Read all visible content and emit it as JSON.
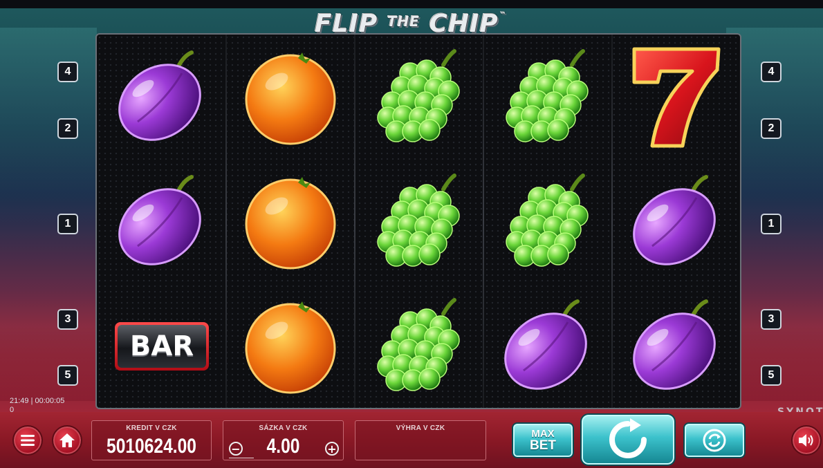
{
  "game": {
    "title_part1": "FLIP",
    "title_part2": "THE",
    "title_part3": "CHIP",
    "trademark": "™"
  },
  "paylines_left": [
    "4",
    "2",
    "1",
    "3",
    "5"
  ],
  "paylines_right": [
    "4",
    "2",
    "1",
    "3",
    "5"
  ],
  "reels": [
    [
      "plum",
      "plum",
      "bar"
    ],
    [
      "orange",
      "orange",
      "orange"
    ],
    [
      "grapes",
      "grapes",
      "grapes"
    ],
    [
      "grapes",
      "grapes",
      "plum"
    ],
    [
      "seven",
      "plum",
      "plum"
    ]
  ],
  "bar_symbol_text": "BAR",
  "status": {
    "clock": "21:49 | 00:00:05",
    "session_value": "0"
  },
  "credit": {
    "label": "KREDIT V CZK",
    "value": "5010624.00"
  },
  "bet": {
    "label": "SÁZKA V CZK",
    "value": "4.00",
    "minus": "−",
    "plus": "+"
  },
  "win": {
    "label": "VÝHRA V CZK",
    "value": ""
  },
  "buttons": {
    "max_bet_line1": "MAX",
    "max_bet_line2": "BET"
  },
  "brand_text": "SYNOT",
  "icons": {
    "menu": "menu-icon",
    "home": "home-icon",
    "spin": "spin-arrow-icon",
    "autoplay": "autoplay-icon",
    "sound": "speaker-icon"
  },
  "colors": {
    "bar_bg": "#8a1825",
    "teal_button": "#3cc2cc",
    "plum": "#8a2fc9",
    "orange": "#f47a12",
    "grape": "#6bd63a",
    "seven_red": "#d8141c"
  }
}
